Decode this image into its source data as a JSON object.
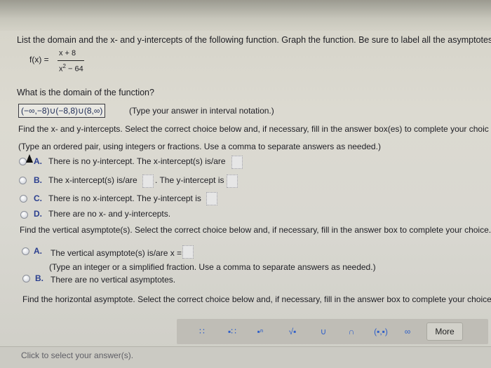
{
  "question": {
    "heading": "List the domain and the x- and y-intercepts of the following function. Graph the function. Be sure to label all the asymptotes.",
    "function_label": "f(x) =",
    "numerator": "x + 8",
    "denominator_base": "x",
    "denominator_exp": "2",
    "denominator_rest": "− 64"
  },
  "domain": {
    "question": "What is the domain of the function?",
    "answer": "(−∞,−8)∪(−8,8)∪(8,∞)",
    "note": "(Type your answer in interval notation.)"
  },
  "intercepts": {
    "question": "Find the x- and y-intercepts. Select the correct choice below and, if necessary, fill in the answer box(es) to complete your choic",
    "note": "(Type an ordered pair, using integers or fractions. Use a comma to separate answers as needed.)",
    "options": [
      {
        "letter": "A.",
        "text": "There is no y-intercept. The x-intercept(s) is/are"
      },
      {
        "letter": "B.",
        "text": "The x-intercept(s) is/are",
        "text2": ". The y-intercept is"
      },
      {
        "letter": "C.",
        "text": "There is no x-intercept. The y-intercept is"
      },
      {
        "letter": "D.",
        "text": "There are no x- and y-intercepts."
      }
    ]
  },
  "vertical": {
    "question": "Find the vertical asymptote(s). Select the correct choice below and, if necessary, fill in the answer box to complete your choice.",
    "options": [
      {
        "letter": "A.",
        "text": "The vertical asymptote(s) is/are x ="
      },
      {
        "letter": "B.",
        "text": "There are no vertical asymptotes."
      }
    ],
    "note": "(Type an integer or a simplified fraction. Use a comma to separate answers as needed.)"
  },
  "horizontal": {
    "question": "Find the horizontal asymptote. Select the correct choice below and, if necessary, fill in the answer box to complete your choice."
  },
  "toolbar": {
    "tools": [
      {
        "icon": "fraction-icon",
        "glyph": "∷"
      },
      {
        "icon": "mixed-number-icon",
        "glyph": "▪∷"
      },
      {
        "icon": "exponent-icon",
        "glyph": "▪ⁿ"
      },
      {
        "icon": "square-root-icon",
        "glyph": "√▪"
      },
      {
        "icon": "union-icon",
        "glyph": "∪"
      },
      {
        "icon": "intersection-icon",
        "glyph": "∩"
      },
      {
        "icon": "interval-icon",
        "glyph": "(▪,▪)"
      },
      {
        "icon": "infinity-icon",
        "glyph": "∞"
      }
    ],
    "more_label": "More"
  },
  "status": {
    "text": "Click to select your answer(s)."
  }
}
